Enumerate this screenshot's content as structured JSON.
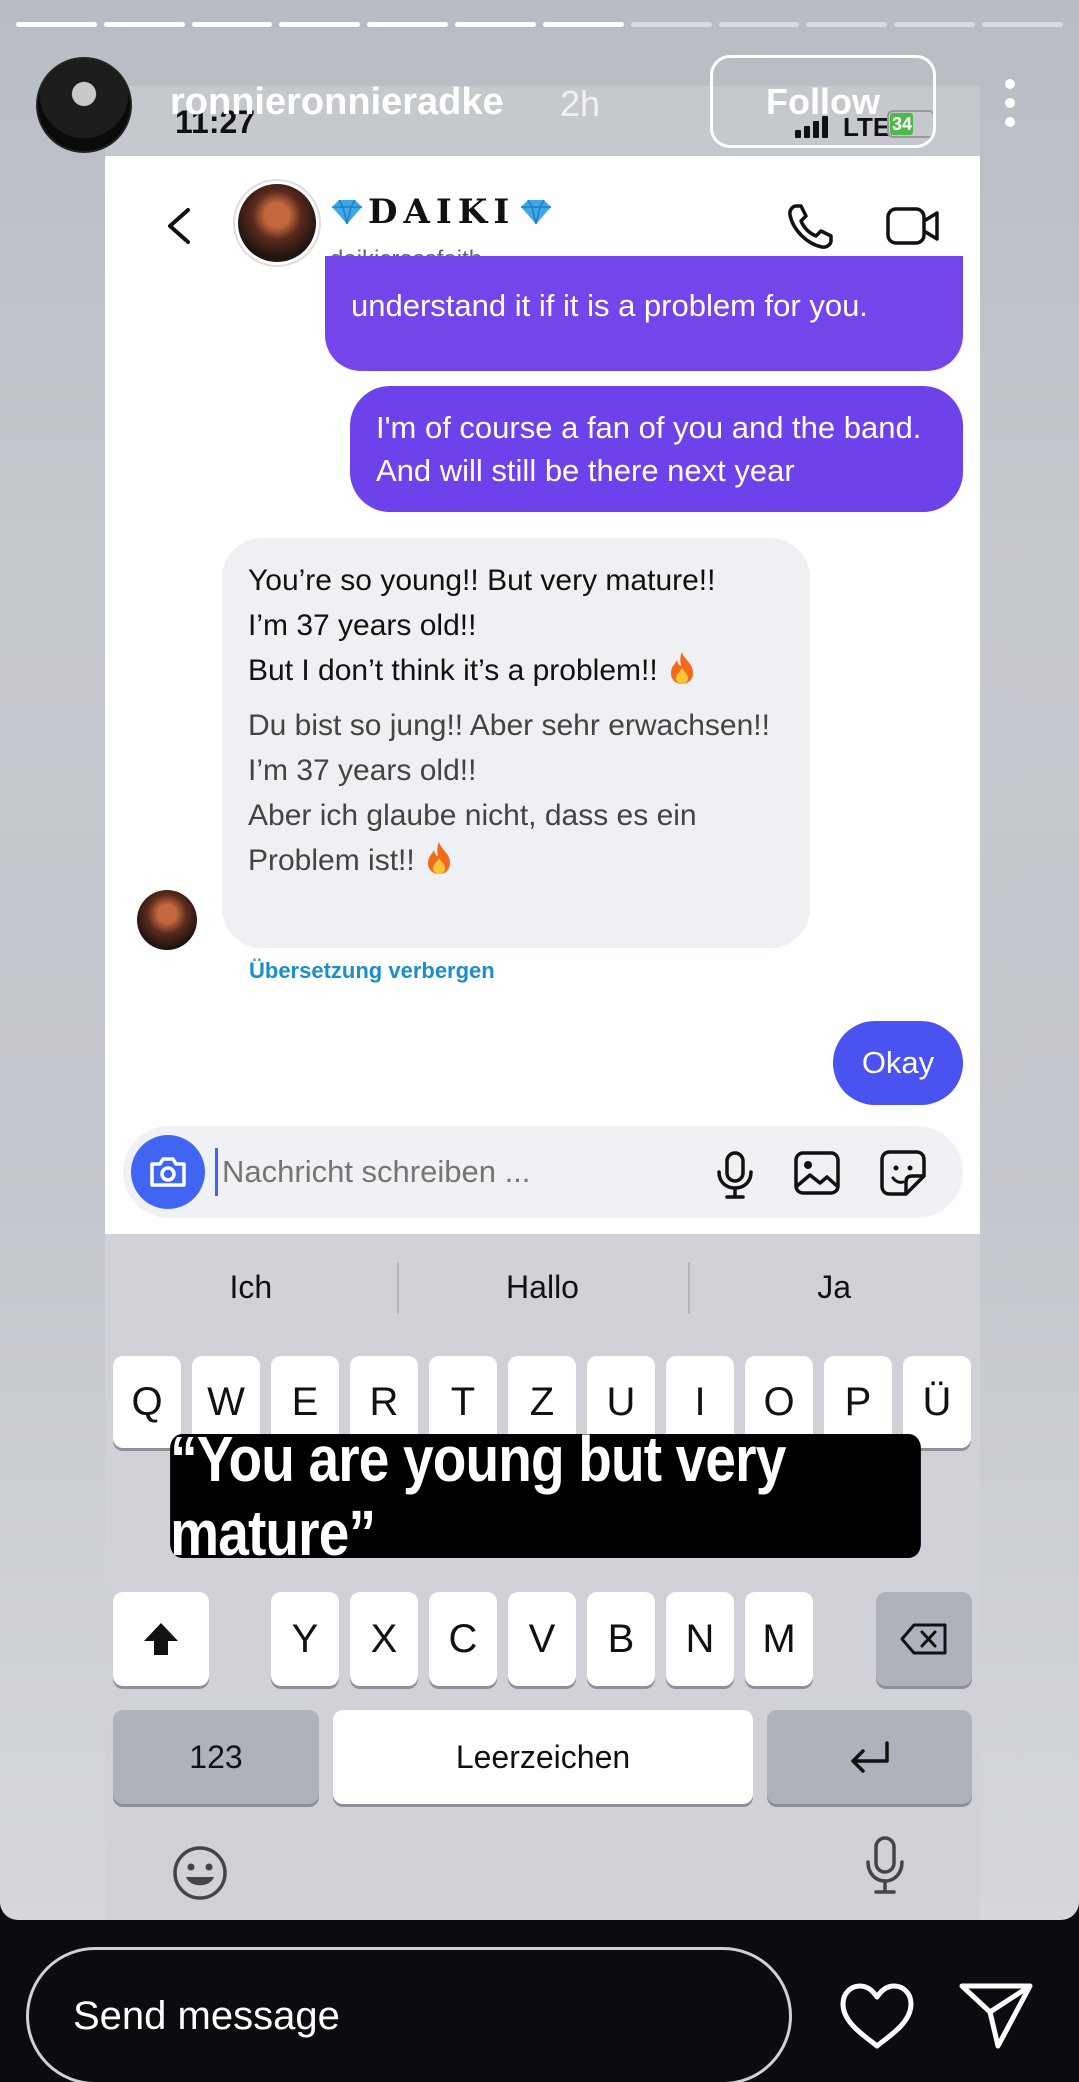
{
  "story": {
    "username": "ronnieronnieradke",
    "time_ago": "2h",
    "follow_label": "Follow",
    "progress_segments": 12,
    "progress_completed": 7
  },
  "status_bar": {
    "time": "11:27",
    "network": "LTE",
    "battery": "34"
  },
  "chat": {
    "name": "DAIKI",
    "name_decoration": "gem-icon",
    "handle": "daikicrossfaith",
    "messages": {
      "partial_out": "understand it if it is a problem for you.",
      "fan_out": "I'm of course a fan of you and the band. And will still be there next year",
      "incoming_original_1": "You’re so young!! But very mature!!",
      "incoming_original_2": "I’m 37 years old!!",
      "incoming_original_3": "But I don’t think it’s a problem!!",
      "incoming_translated_1": "Du bist so jung!! Aber sehr erwachsen!!",
      "incoming_translated_2": "I’m 37 years old!!",
      "incoming_translated_3": "Aber ich glaube nicht, dass es ein Problem ist!!",
      "hide_translation": "Übersetzung verbergen",
      "okay_out": "Okay"
    },
    "composer_placeholder": "Nachricht schreiben ..."
  },
  "keyboard": {
    "suggestions": [
      "Ich",
      "Hallo",
      "Ja"
    ],
    "row1": [
      "Q",
      "W",
      "E",
      "R",
      "T",
      "Z",
      "U",
      "I",
      "O",
      "P",
      "Ü"
    ],
    "row3": [
      "Y",
      "X",
      "C",
      "V",
      "B",
      "N",
      "M"
    ],
    "numbers_key": "123",
    "space_key": "Leerzeichen"
  },
  "caption": "“You are young but very mature”",
  "bottom_bar": {
    "send_placeholder": "Send message"
  },
  "colors": {
    "outgoing_bubble": "#6f3be8",
    "okay_bubble": "#4a52f0",
    "incoming_bubble": "#eef0f4",
    "link": "#1a8fc9",
    "camera_button": "#3f65f2"
  }
}
